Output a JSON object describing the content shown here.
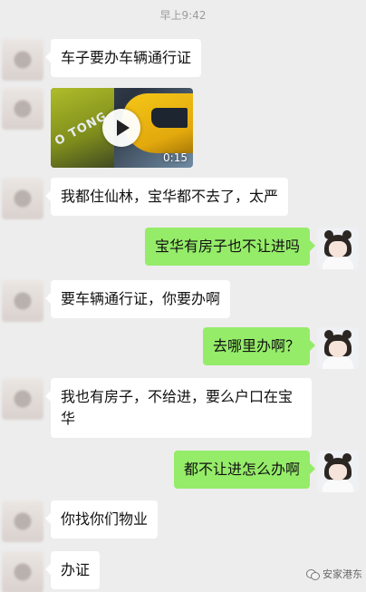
{
  "header": {
    "time": "早上9:42"
  },
  "messages": [
    {
      "side": "in",
      "text": "车子要办车辆通行证"
    },
    {
      "side": "in",
      "type": "video",
      "duration": "0:15",
      "thumb_text": "O TONG"
    },
    {
      "side": "in",
      "text": "我都住仙林，宝华都不去了，太严"
    },
    {
      "side": "out",
      "text": "宝华有房子也不让进吗"
    },
    {
      "side": "in",
      "text": "要车辆通行证，你要办啊"
    },
    {
      "side": "out",
      "text": "去哪里办啊？"
    },
    {
      "side": "in",
      "text": "我也有房子，不给进，要么户口在宝华"
    },
    {
      "side": "out",
      "text": "都不让进怎么办啊"
    },
    {
      "side": "in",
      "text": "你找你们物业"
    },
    {
      "side": "in",
      "text": "办证"
    }
  ],
  "watermark": {
    "text": "安家港东"
  },
  "colors": {
    "background": "#ededed",
    "incoming": "#ffffff",
    "outgoing": "#95ec69"
  }
}
